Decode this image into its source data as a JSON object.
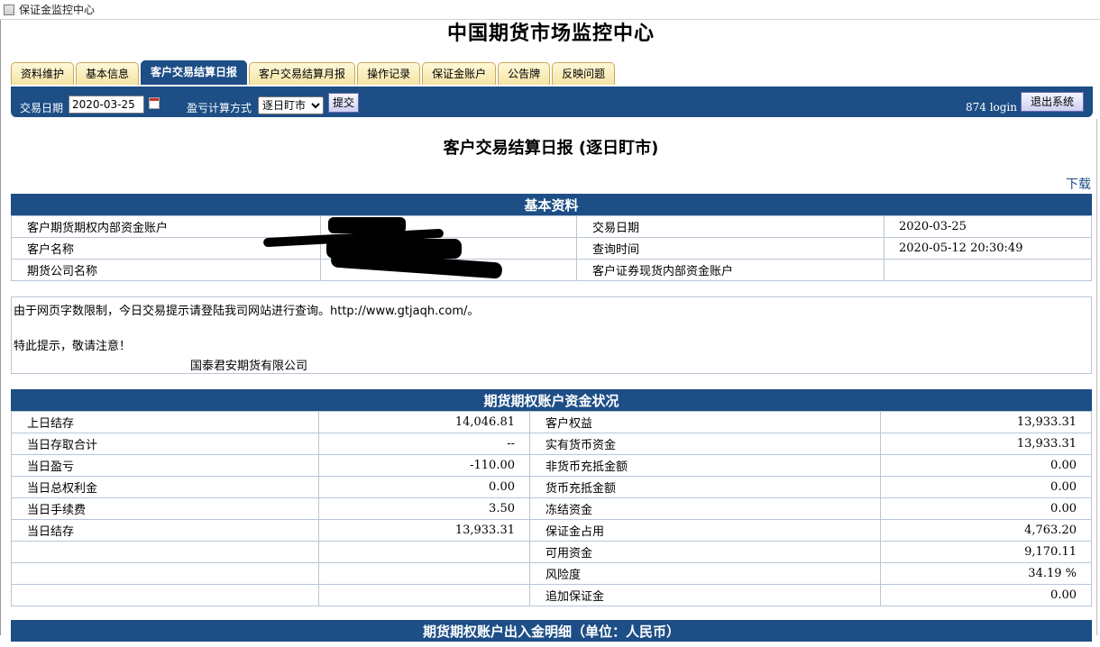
{
  "window": {
    "title": "保证金监控中心"
  },
  "header": {
    "title": "中国期货市场监控中心"
  },
  "tabs": [
    "资料维护",
    "基本信息",
    "客户交易结算日报",
    "客户交易结算月报",
    "操作记录",
    "保证金账户",
    "公告牌",
    "反映问题"
  ],
  "active_tab": "客户交易结算日报",
  "toolbar": {
    "date_label": "交易日期",
    "date_value": "2020-03-25",
    "calc_label": "盈亏计算方式",
    "calc_selected": "逐日盯市",
    "submit_label": "提交",
    "login_text": "874 login",
    "logout_label": "退出系统"
  },
  "report": {
    "title": "客户交易结算日报 (逐日盯市)",
    "download_label": "下载"
  },
  "basic_info": {
    "heading": "基本资料",
    "rows": [
      {
        "l1": "客户期货期权内部资金账户",
        "v1": "",
        "l2": "交易日期",
        "v2": "2020-03-25"
      },
      {
        "l1": "客户名称",
        "v1": "",
        "l2": "查询时间",
        "v2": "2020-05-12 20:30:49"
      },
      {
        "l1": "期货公司名称",
        "v1": "",
        "l2": "客户证券现货内部资金账户",
        "v2": ""
      }
    ]
  },
  "notice": {
    "line1": "由于网页字数限制，今日交易提示请登陆我司网站进行查询。http://www.gtjaqh.com/。",
    "line2": "特此提示，敬请注意！",
    "signature": "国泰君安期货有限公司"
  },
  "funds": {
    "heading": "期货期权账户资金状况",
    "rows": [
      {
        "l1": "上日结存",
        "v1": "14,046.81",
        "l2": "客户权益",
        "v2": "13,933.31"
      },
      {
        "l1": "当日存取合计",
        "v1": "--",
        "l2": "实有货币资金",
        "v2": "13,933.31"
      },
      {
        "l1": "当日盈亏",
        "v1": "-110.00",
        "l2": "非货币充抵金额",
        "v2": "0.00"
      },
      {
        "l1": "当日总权利金",
        "v1": "0.00",
        "l2": "货币充抵金额",
        "v2": "0.00"
      },
      {
        "l1": "当日手续费",
        "v1": "3.50",
        "l2": "冻结资金",
        "v2": "0.00"
      },
      {
        "l1": "当日结存",
        "v1": "13,933.31",
        "l2": "保证金占用",
        "v2": "4,763.20"
      },
      {
        "l1": "",
        "v1": "",
        "l2": "可用资金",
        "v2": "9,170.11"
      },
      {
        "l1": "",
        "v1": "",
        "l2": "风险度",
        "v2": "34.19 %"
      },
      {
        "l1": "",
        "v1": "",
        "l2": "追加保证金",
        "v2": "0.00"
      }
    ]
  },
  "inout": {
    "heading": "期货期权账户出入金明细（单位：人民币）"
  }
}
